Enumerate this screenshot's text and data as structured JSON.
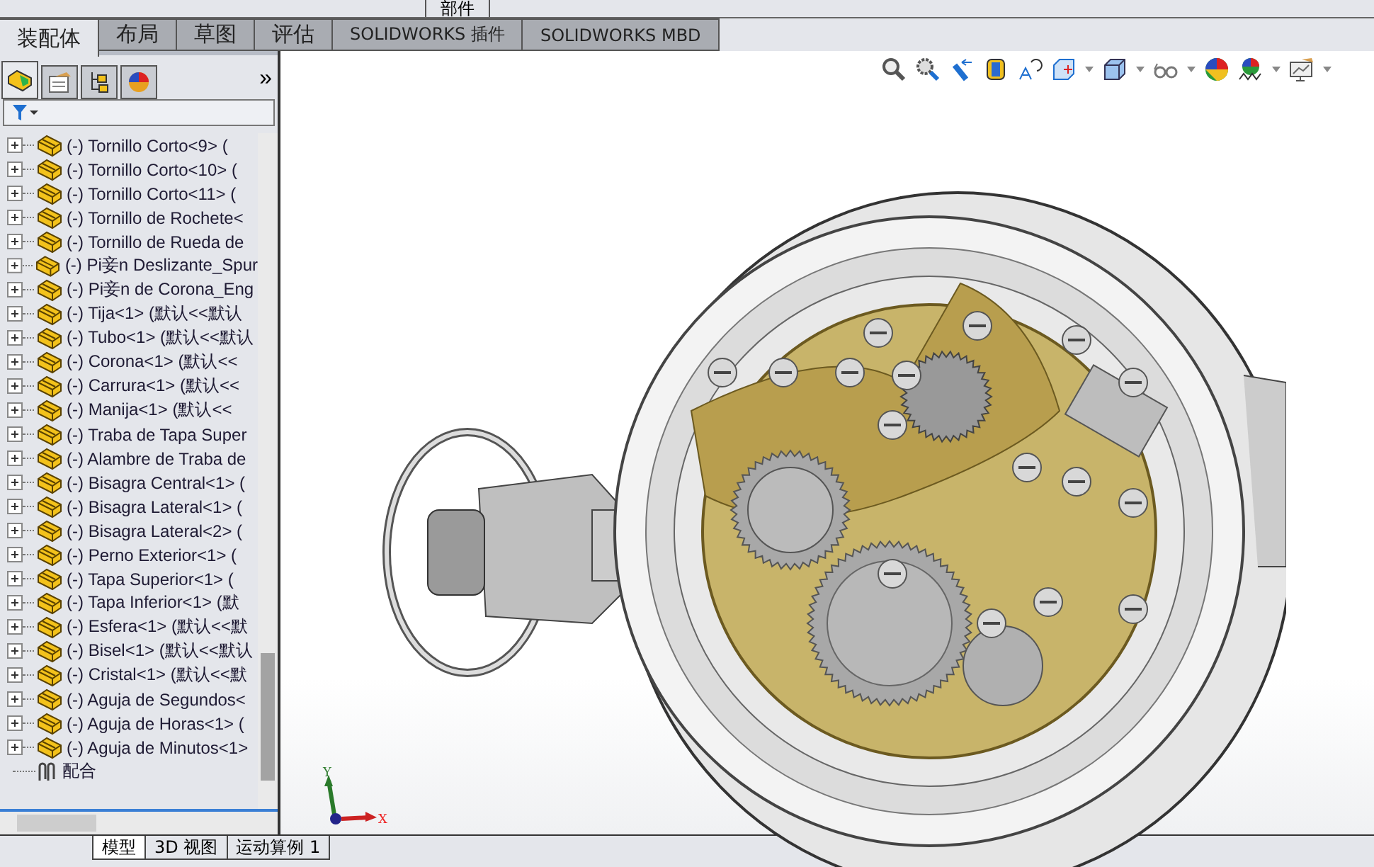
{
  "top_toolbar": {
    "label": "部件"
  },
  "tabs": [
    {
      "label": "装配体",
      "selected": true
    },
    {
      "label": "布局",
      "selected": false
    },
    {
      "label": "草图",
      "selected": false
    },
    {
      "label": "评估",
      "selected": false
    },
    {
      "label": "SOLIDWORKS 插件",
      "selected": false
    },
    {
      "label": "SOLIDWORKS MBD",
      "selected": false
    }
  ],
  "panel_tabs": [
    {
      "kind": "feature-tree",
      "selected": true
    },
    {
      "kind": "properties",
      "selected": false
    },
    {
      "kind": "configurations",
      "selected": false
    },
    {
      "kind": "appearance",
      "selected": false
    }
  ],
  "panel_more": "»",
  "tree": {
    "items": [
      {
        "label": "(-) Tornillo Corto<9> (",
        "kind": "part"
      },
      {
        "label": "(-) Tornillo Corto<10> (",
        "kind": "part"
      },
      {
        "label": "(-) Tornillo Corto<11> (",
        "kind": "part"
      },
      {
        "label": "(-) Tornillo de Rochete<",
        "kind": "part"
      },
      {
        "label": "(-) Tornillo de Rueda de",
        "kind": "part"
      },
      {
        "label": "(-) Pi妾n Deslizante_Spur",
        "kind": "part"
      },
      {
        "label": "(-) Pi妾n de Corona_Eng",
        "kind": "part"
      },
      {
        "label": "(-) Tija<1> (默认<<默认",
        "kind": "part"
      },
      {
        "label": "(-) Tubo<1> (默认<<默认",
        "kind": "part"
      },
      {
        "label": "(-) Corona<1> (默认<<",
        "kind": "part"
      },
      {
        "label": "(-) Carrura<1> (默认<<",
        "kind": "part"
      },
      {
        "label": "(-) Manija<1> (默认<<",
        "kind": "part"
      },
      {
        "label": "(-) Traba de Tapa Super",
        "kind": "part"
      },
      {
        "label": "(-) Alambre de Traba de",
        "kind": "part"
      },
      {
        "label": "(-) Bisagra Central<1> (",
        "kind": "part"
      },
      {
        "label": "(-) Bisagra Lateral<1> (",
        "kind": "part"
      },
      {
        "label": "(-) Bisagra Lateral<2> (",
        "kind": "part"
      },
      {
        "label": "(-) Perno Exterior<1> (",
        "kind": "part"
      },
      {
        "label": "(-) Tapa Superior<1> (",
        "kind": "part"
      },
      {
        "label": "(-) Tapa Inferior<1> (默",
        "kind": "part"
      },
      {
        "label": "(-) Esfera<1> (默认<<默",
        "kind": "part"
      },
      {
        "label": "(-) Bisel<1> (默认<<默认",
        "kind": "part"
      },
      {
        "label": "(-) Cristal<1> (默认<<默",
        "kind": "part"
      },
      {
        "label": "(-) Aguja de Segundos<",
        "kind": "part"
      },
      {
        "label": "(-) Aguja de Horas<1> (",
        "kind": "part"
      },
      {
        "label": "(-) Aguja de Minutos<1>",
        "kind": "part"
      },
      {
        "label": "配合",
        "kind": "mates"
      }
    ]
  },
  "triad": {
    "x_label": "X",
    "y_label": "Y"
  },
  "bottom_tabs": [
    {
      "label": "模型",
      "selected": true
    },
    {
      "label": "3D 视图",
      "selected": false
    },
    {
      "label": "运动算例 1",
      "selected": false
    }
  ]
}
